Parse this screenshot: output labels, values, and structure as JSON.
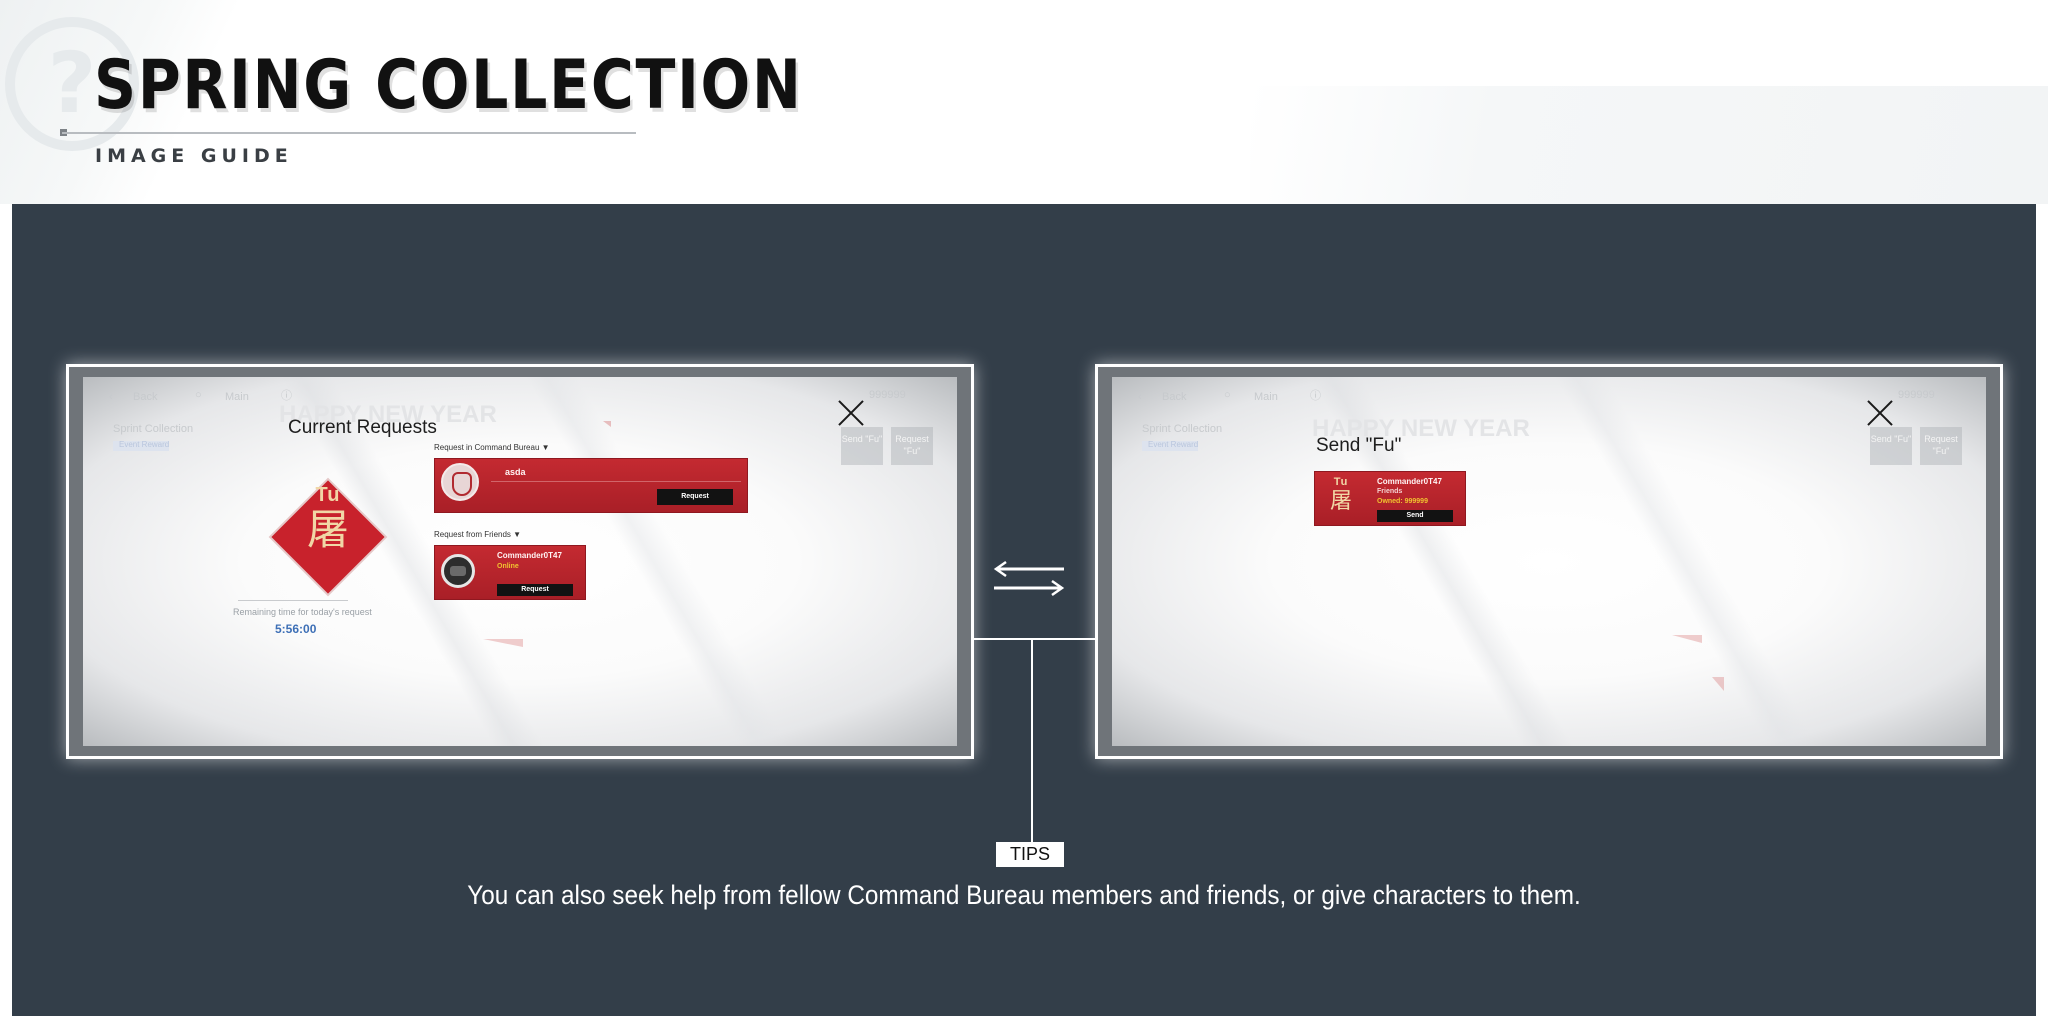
{
  "header": {
    "title": "SPRING COLLECTION",
    "subtitle": "IMAGE GUIDE"
  },
  "screenshot_left": {
    "nav": {
      "back": "Back",
      "main": "Main",
      "currency": "999999"
    },
    "sidebar": {
      "title": "Sprint Collection",
      "button": "Event Reward"
    },
    "background_banner": "HAPPY NEW YEAR",
    "corner_buttons": [
      "Send \"Fu\"",
      "Request \"Fu\""
    ],
    "dialog": {
      "title": "Current Requests",
      "fu_card": {
        "latin": "Tu",
        "character": "屠"
      },
      "remaining_label": "Remaining time for today's request",
      "remaining_time": "5:56:00",
      "bureau_section": {
        "label": "Request in Command Bureau",
        "name": "asda",
        "button": "Request"
      },
      "friends_section": {
        "label": "Request from Friends",
        "name": "Commander0T47",
        "status": "Online",
        "button": "Request"
      }
    }
  },
  "screenshot_right": {
    "nav": {
      "back": "Back",
      "main": "Main",
      "currency": "999999"
    },
    "sidebar": {
      "title": "Sprint Collection",
      "button": "Event Reward"
    },
    "background_banner": "HAPPY NEW YEAR",
    "corner_buttons": [
      "Send \"Fu\"",
      "Request \"Fu\""
    ],
    "dialog": {
      "title": "Send \"Fu\"",
      "card": {
        "latin": "Tu",
        "character": "屠",
        "name": "Commander0T47",
        "relation": "Friends",
        "owned": "Owned: 999999",
        "button": "Send"
      }
    }
  },
  "tips": {
    "label": "TIPS",
    "text": "You can also seek help from fellow Command Bureau members and friends, or give characters to them."
  },
  "colors": {
    "panel": "#333e49",
    "fu_red": "#c8222c",
    "card_red": "#b2232b",
    "time_blue": "#3d6fb6",
    "status_yellow": "#f0c230"
  }
}
